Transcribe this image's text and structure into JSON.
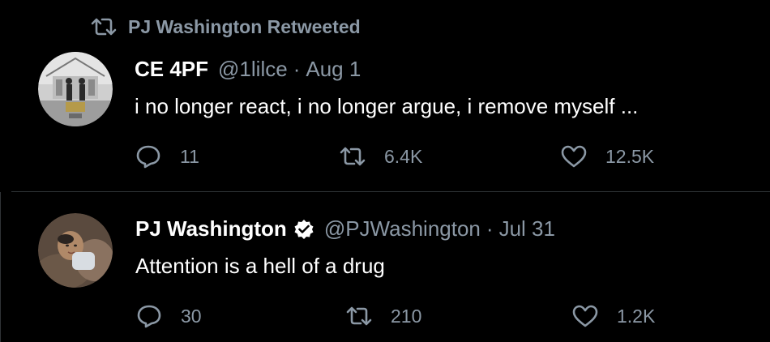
{
  "colors": {
    "background": "#000000",
    "text_primary": "#ffffff",
    "text_secondary": "#8b98a5",
    "divider": "#2f3336",
    "verified_badge": "#ffffff"
  },
  "retweet_banner": {
    "icon": "retweet-icon",
    "text": "PJ Washington Retweeted"
  },
  "tweets": [
    {
      "display_name": "CE 4PF",
      "handle": "@1lilce",
      "separator": "·",
      "date": "Aug 1",
      "verified": false,
      "text": "i no longer react, i no longer argue, i remove myself ...",
      "replies": "11",
      "retweets": "6.4K",
      "likes": "12.5K"
    },
    {
      "display_name": "PJ Washington",
      "handle": "@PJWashington",
      "separator": "·",
      "date": "Jul 31",
      "verified": true,
      "text": "Attention is a hell of a drug",
      "replies": "30",
      "retweets": "210",
      "likes": "1.2K"
    }
  ]
}
